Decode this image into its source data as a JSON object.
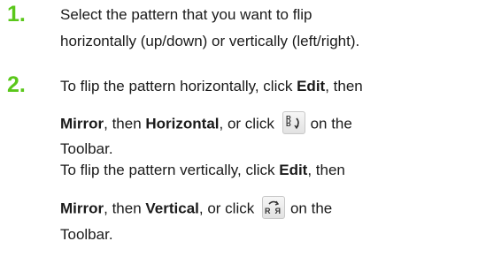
{
  "accent": "#5ac71a",
  "steps": [
    {
      "number": "1.",
      "line1": "Select the pattern that you want to flip",
      "line2": "horizontally (up/down) or vertically (left/right)."
    },
    {
      "number": "2.",
      "h_line1": "To flip the pattern horizontally, click ",
      "h_edit": "Edit",
      "h_then1": ", then",
      "h_mirror": "Mirror",
      "h_then2": ", then ",
      "h_horizontal": "Horizontal",
      "h_or": ", or click",
      "h_on": "on the",
      "h_toolbar": "Toolbar.",
      "v_line1": "To flip the pattern vertically, click ",
      "v_edit": "Edit",
      "v_then1": ", then",
      "v_mirror": "Mirror",
      "v_then2": ", then ",
      "v_vertical": "Vertical",
      "v_or": ", or click",
      "v_on": "on the",
      "v_toolbar": "Toolbar."
    }
  ],
  "icons": {
    "flip_horizontal": "mirror-horizontal-icon",
    "flip_vertical": "mirror-vertical-icon"
  }
}
